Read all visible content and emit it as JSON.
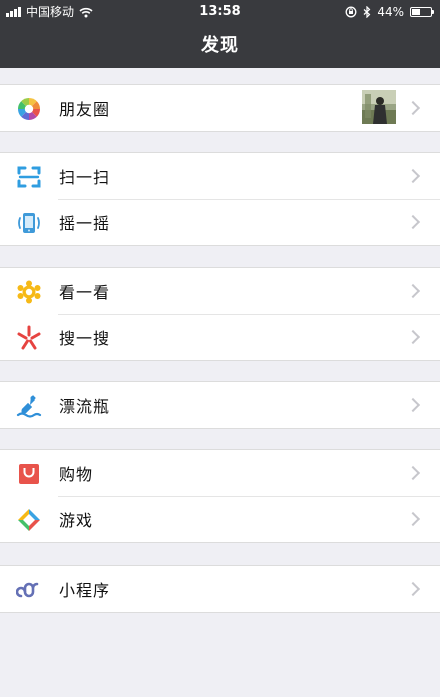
{
  "status_bar": {
    "carrier": "中国移动",
    "time": "13:58",
    "battery": "44%",
    "battery_level": 0.44,
    "icons": [
      "signal-icon",
      "wifi-icon",
      "rotation-lock-icon",
      "bluetooth-icon",
      "battery-icon"
    ]
  },
  "nav": {
    "title": "发现"
  },
  "menu": {
    "moments": "朋友圈",
    "scan": "扫一扫",
    "shake": "摇一摇",
    "top_stories": "看一看",
    "search": "搜一搜",
    "drift_bottle": "漂流瓶",
    "shopping": "购物",
    "games": "游戏",
    "mini_programs": "小程序"
  },
  "colors": {
    "header_bg": "#393a3e",
    "page_bg": "#efeff4",
    "scan_blue": "#2f9de0",
    "shake_blue": "#3f9ad9",
    "top_stories_yellow": "#f6b917",
    "search_red": "#e64340",
    "drift_blue": "#2f8fd8",
    "shopping_red": "#e8534b",
    "mini_program_blue": "#6470b5"
  }
}
